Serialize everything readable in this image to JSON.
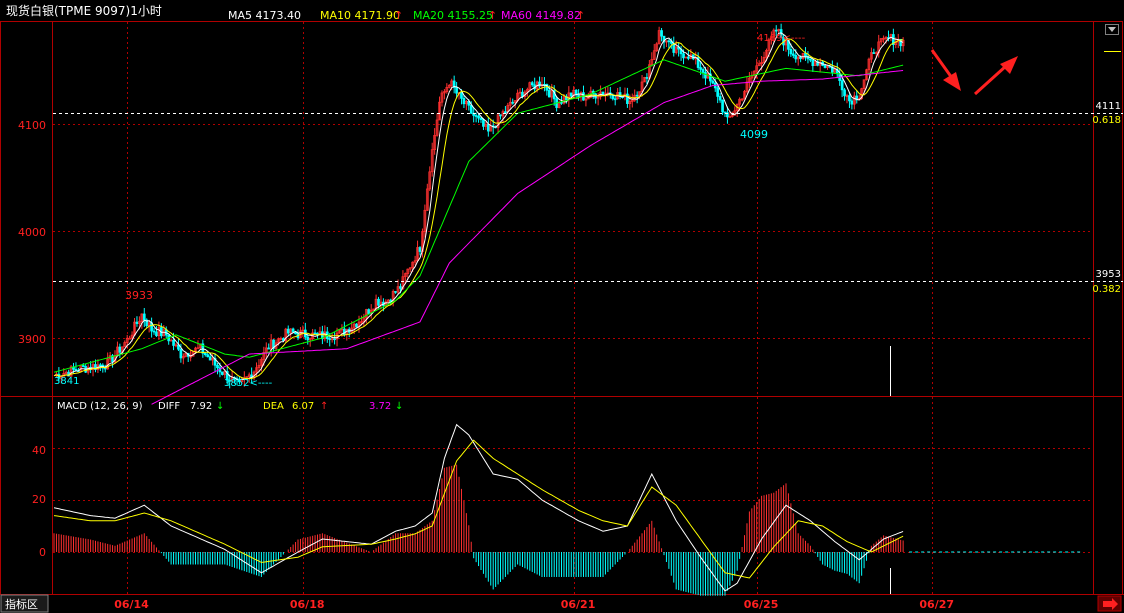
{
  "header": {
    "instrument": "现货白银(TPME 9097)1小时",
    "ma_labels": [
      {
        "label": "MA5 4173.40",
        "color": "#ffffff",
        "arrow": ""
      },
      {
        "label": "MA10 4171.90",
        "color": "#ffff00",
        "arrow": "↑"
      },
      {
        "label": "MA20 4155.25",
        "color": "#00ff00",
        "arrow": "↑"
      },
      {
        "label": "MA60 4149.82",
        "color": "#ff00ff",
        "arrow": "↑"
      }
    ]
  },
  "macd_header": {
    "title": "MACD (12, 26, 9)",
    "diff_label": "DIFF",
    "diff_value": "7.92",
    "diff_arrow": "↓",
    "dea_label": "DEA",
    "dea_value": "6.07",
    "dea_arrow": "↑",
    "macd_value": "3.72",
    "macd_arrow": "↓"
  },
  "price_axis_labels": [
    "4100",
    "4000",
    "3900"
  ],
  "macd_axis_labels": [
    "40",
    "20",
    "0"
  ],
  "date_labels": [
    "06/14",
    "06/18",
    "06/21",
    "06/25",
    "06/27"
  ],
  "fib_levels": [
    {
      "price": "4111",
      "ratio": "0.618"
    },
    {
      "price": "3953",
      "ratio": "0.382"
    }
  ],
  "annotations": {
    "high_1": "3933",
    "low_1": "3852<----",
    "low_left": "3841",
    "high_2": "4189<----",
    "low_2": "4099"
  },
  "footer": {
    "indicator_tab": "指标区"
  },
  "colors": {
    "up": "#ff3030",
    "down": "#00ffff",
    "grid": "#b00000",
    "axis_text": "#ff2020",
    "ma5": "#ffffff",
    "ma10": "#ffff00",
    "ma20": "#00ff00",
    "ma60": "#ff00ff",
    "arrow": "#ff2020"
  },
  "chart_data": {
    "type": "candlestick",
    "title": "现货白银(TPME 9097)1小时",
    "y_range": [
      3840,
      4195
    ],
    "price_path": [
      [
        0,
        3865
      ],
      [
        10,
        3871
      ],
      [
        22,
        3876
      ],
      [
        30,
        3898
      ],
      [
        36,
        3922
      ],
      [
        40,
        3908
      ],
      [
        46,
        3903
      ],
      [
        52,
        3885
      ],
      [
        60,
        3890
      ],
      [
        66,
        3875
      ],
      [
        72,
        3862
      ],
      [
        76,
        3855
      ],
      [
        82,
        3870
      ],
      [
        88,
        3892
      ],
      [
        96,
        3905
      ],
      [
        104,
        3903
      ],
      [
        110,
        3902
      ],
      [
        118,
        3905
      ],
      [
        126,
        3918
      ],
      [
        132,
        3935
      ],
      [
        136,
        3934
      ],
      [
        142,
        3948
      ],
      [
        146,
        3968
      ],
      [
        150,
        3985
      ],
      [
        154,
        4060
      ],
      [
        158,
        4120
      ],
      [
        162,
        4140
      ],
      [
        166,
        4125
      ],
      [
        172,
        4108
      ],
      [
        178,
        4092
      ],
      [
        184,
        4110
      ],
      [
        192,
        4130
      ],
      [
        200,
        4140
      ],
      [
        206,
        4120
      ],
      [
        212,
        4128
      ],
      [
        218,
        4125
      ],
      [
        224,
        4130
      ],
      [
        230,
        4128
      ],
      [
        236,
        4122
      ],
      [
        242,
        4140
      ],
      [
        248,
        4185
      ],
      [
        254,
        4168
      ],
      [
        260,
        4165
      ],
      [
        266,
        4150
      ],
      [
        272,
        4128
      ],
      [
        276,
        4102
      ],
      [
        280,
        4118
      ],
      [
        286,
        4145
      ],
      [
        292,
        4170
      ],
      [
        296,
        4188
      ],
      [
        302,
        4168
      ],
      [
        308,
        4160
      ],
      [
        314,
        4158
      ],
      [
        320,
        4150
      ],
      [
        326,
        4122
      ],
      [
        330,
        4128
      ],
      [
        336,
        4170
      ],
      [
        342,
        4180
      ],
      [
        348,
        4177
      ]
    ],
    "ma60_path": [
      [
        40,
        3838
      ],
      [
        80,
        3885
      ],
      [
        120,
        3890
      ],
      [
        150,
        3915
      ],
      [
        162,
        3970
      ],
      [
        190,
        4035
      ],
      [
        220,
        4080
      ],
      [
        250,
        4120
      ],
      [
        270,
        4136
      ],
      [
        290,
        4140
      ],
      [
        315,
        4142
      ],
      [
        348,
        4150
      ]
    ],
    "ma20_path": [
      [
        0,
        3868
      ],
      [
        36,
        3890
      ],
      [
        50,
        3903
      ],
      [
        70,
        3885
      ],
      [
        80,
        3882
      ],
      [
        110,
        3900
      ],
      [
        140,
        3935
      ],
      [
        150,
        3958
      ],
      [
        170,
        4065
      ],
      [
        190,
        4110
      ],
      [
        220,
        4128
      ],
      [
        250,
        4160
      ],
      [
        275,
        4140
      ],
      [
        300,
        4152
      ],
      [
        330,
        4145
      ],
      [
        348,
        4155
      ]
    ],
    "macd_diff": [
      [
        0,
        17
      ],
      [
        15,
        14
      ],
      [
        25,
        13
      ],
      [
        37,
        18
      ],
      [
        48,
        10
      ],
      [
        70,
        1
      ],
      [
        85,
        -8
      ],
      [
        100,
        0
      ],
      [
        110,
        5
      ],
      [
        130,
        3
      ],
      [
        140,
        8
      ],
      [
        148,
        10
      ],
      [
        155,
        15
      ],
      [
        160,
        36
      ],
      [
        165,
        49
      ],
      [
        170,
        45
      ],
      [
        180,
        30
      ],
      [
        190,
        28
      ],
      [
        200,
        20
      ],
      [
        215,
        12
      ],
      [
        225,
        8
      ],
      [
        235,
        10
      ],
      [
        245,
        30
      ],
      [
        255,
        12
      ],
      [
        265,
        -2
      ],
      [
        275,
        -15
      ],
      [
        280,
        -12
      ],
      [
        290,
        5
      ],
      [
        300,
        18
      ],
      [
        310,
        12
      ],
      [
        320,
        4
      ],
      [
        330,
        -3
      ],
      [
        340,
        5
      ],
      [
        348,
        7.92
      ]
    ],
    "macd_dea": [
      [
        0,
        14
      ],
      [
        15,
        12
      ],
      [
        25,
        12
      ],
      [
        37,
        15
      ],
      [
        48,
        12
      ],
      [
        70,
        3
      ],
      [
        85,
        -4
      ],
      [
        100,
        -2
      ],
      [
        110,
        2
      ],
      [
        130,
        3
      ],
      [
        140,
        5
      ],
      [
        148,
        7
      ],
      [
        155,
        10
      ],
      [
        165,
        35
      ],
      [
        172,
        43
      ],
      [
        180,
        36
      ],
      [
        190,
        30
      ],
      [
        200,
        24
      ],
      [
        215,
        16
      ],
      [
        225,
        12
      ],
      [
        235,
        10
      ],
      [
        245,
        25
      ],
      [
        255,
        18
      ],
      [
        265,
        5
      ],
      [
        275,
        -8
      ],
      [
        285,
        -10
      ],
      [
        295,
        2
      ],
      [
        305,
        12
      ],
      [
        315,
        10
      ],
      [
        325,
        4
      ],
      [
        335,
        0
      ],
      [
        348,
        6.07
      ]
    ],
    "macd_range": [
      -22,
      52
    ],
    "date_positions": [
      {
        "label": "06/14",
        "index": 30
      },
      {
        "label": "06/18",
        "index": 102
      },
      {
        "label": "06/21",
        "index": 213
      },
      {
        "label": "06/25",
        "index": 288
      },
      {
        "label": "06/27",
        "index": 360
      }
    ]
  }
}
